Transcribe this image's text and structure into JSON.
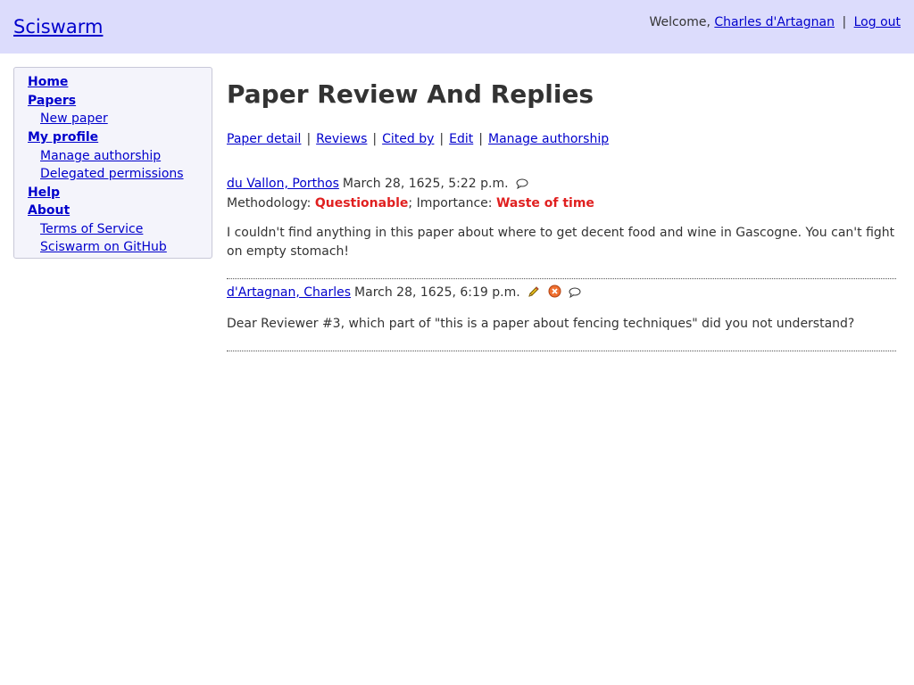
{
  "header": {
    "site_title": "Sciswarm",
    "welcome_text": "Welcome,",
    "user_name": "Charles d'Artagnan",
    "separator": "|",
    "logout_label": "Log out"
  },
  "sidebar": {
    "items": [
      {
        "label": "Home"
      },
      {
        "label": "Papers"
      },
      {
        "label": "New paper"
      },
      {
        "label": "My profile"
      },
      {
        "label": "Manage authorship"
      },
      {
        "label": "Delegated permissions"
      },
      {
        "label": "Help"
      },
      {
        "label": "About"
      },
      {
        "label": "Terms of Service"
      },
      {
        "label": "Sciswarm on GitHub"
      }
    ]
  },
  "main": {
    "title": "Paper Review And Replies",
    "tabs": [
      {
        "label": "Paper detail"
      },
      {
        "label": "Reviews"
      },
      {
        "label": "Cited by"
      },
      {
        "label": "Edit"
      },
      {
        "label": "Manage authorship"
      }
    ],
    "tab_separator": "|",
    "review": {
      "author": "du Vallon, Porthos",
      "date": "March 28, 1625, 5:22 p.m.",
      "methodology_label": "Methodology:",
      "methodology_value": "Questionable",
      "importance_label": "; Importance:",
      "importance_value": "Waste of time",
      "text": "I couldn't find anything in this paper about where to get decent food and wine in Gascogne. You can't fight on empty stomach!",
      "reply_icon": "speech-bubble-icon"
    },
    "reply": {
      "author": "d'Artagnan, Charles",
      "date": "March 28, 1625, 6:19 p.m.",
      "text": "Dear Reviewer #3, which part of \"this is a paper about fencing techniques\" did you not understand?",
      "edit_icon": "pencil-icon",
      "delete_icon": "delete-icon",
      "reply_icon": "speech-bubble-icon"
    }
  },
  "colors": {
    "header_bg": "#dcdcfc",
    "sidebar_bg": "#f4f4fb",
    "link": "#0000cc",
    "rating_value": "#e02020"
  }
}
